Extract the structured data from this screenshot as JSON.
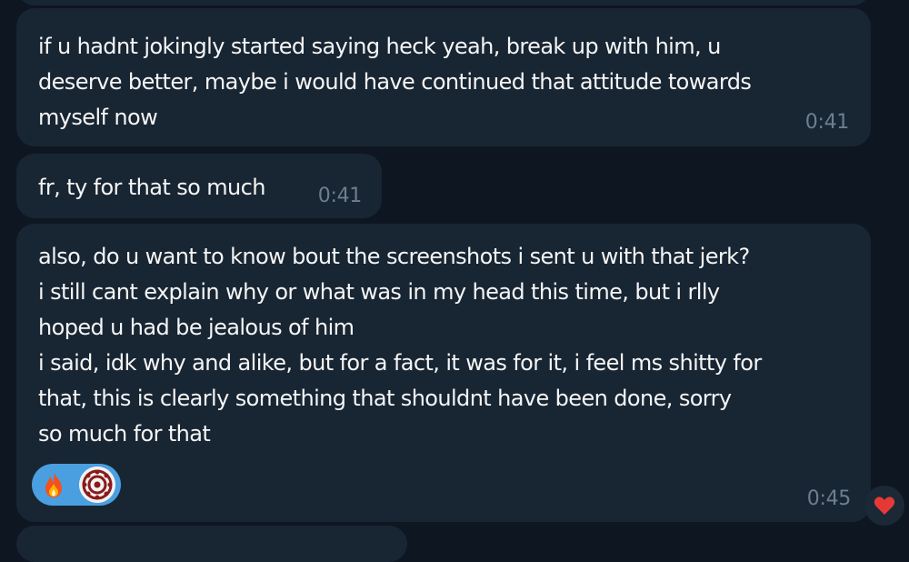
{
  "messages": [
    {
      "text": "if u hadnt jokingly started saying heck yeah, break up with him, u\ndeserve better, maybe i would have continued that attitude towards\nmyself now",
      "time": "0:41"
    },
    {
      "text": "fr, ty for that so much",
      "time": "0:41"
    },
    {
      "text": "also, do u want to know bout the screenshots i sent u with that jerk?\ni still cant explain why or what was in my head this time, but i rlly\nhoped u had be jealous of him\ni said, idk why and alike, but for a fact, it was for it, i feel ms shitty for\nthat, this is clearly something that shouldnt have been done, sorry\nso much for that",
      "time": "0:45",
      "reactions": [
        "fire-icon",
        "avatar"
      ]
    }
  ],
  "colors": {
    "background": "#0e1621",
    "bubble": "#182533",
    "text": "#f5f5f5",
    "time": "#6d7f8f",
    "reaction_pill": "#4a9fe0",
    "heart": "#e53935"
  },
  "side_reaction": "heart-icon"
}
